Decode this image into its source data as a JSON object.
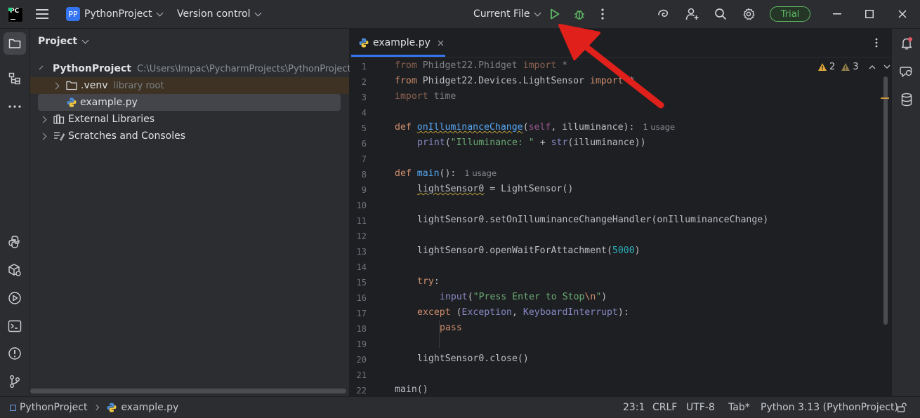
{
  "titlebar": {
    "app_logo": "PC",
    "project_badge": "PP",
    "project_name": "PythonProject",
    "vcs_label": "Version control",
    "run_config": "Current File",
    "trial_label": "Trial"
  },
  "project_panel": {
    "title": "Project",
    "tree": {
      "root_name": "PythonProject",
      "root_path": "C:\\Users\\Impac\\PycharmProjects\\PythonProject",
      "venv_name": ".venv",
      "venv_hint": "library root",
      "file_name": "example.py",
      "external_libraries": "External Libraries",
      "scratches": "Scratches and Consoles"
    }
  },
  "editor": {
    "tab_label": "example.py",
    "warnings_count": "2",
    "weak_warnings_count": "3",
    "line_numbers": [
      "1",
      "2",
      "3",
      "4",
      "5",
      "6",
      "7",
      "8",
      "9",
      "10",
      "11",
      "12",
      "13",
      "14",
      "15",
      "16",
      "17",
      "18",
      "19",
      "20",
      "21",
      "22"
    ],
    "code": {
      "l1_kw": "from",
      "l1_mod": " Phidget22.Phidget ",
      "l1_kw2": "import",
      "l1_rest": " *",
      "l2_kw": "from",
      "l2_mod": " Phidget22.Devices.LightSensor ",
      "l2_kw2": "import",
      "l2_rest": " *",
      "l3_kw": "import",
      "l3_rest": " time",
      "l5_kw": "def ",
      "l5_fn": "onIlluminanceChange",
      "l5_p1": "(",
      "l5_self": "self",
      "l5_p2": ", illuminance):",
      "l5_hint": "1 usage",
      "l6_fn": "print",
      "l6_p1": "(",
      "l6_str": "\"Illuminance: \"",
      "l6_p2": " + ",
      "l6_bi": "str",
      "l6_p3": "(illuminance))",
      "l8_kw": "def ",
      "l8_fn": "main",
      "l8_rest": "():",
      "l8_hint": "1 usage",
      "l9_var": "lightSensor0",
      "l9_rest": " = LightSensor()",
      "l11": "lightSensor0.setOnIlluminanceChangeHandler(onIlluminanceChange)",
      "l13_a": "lightSensor0.openWaitForAttachment(",
      "l13_num": "5000",
      "l13_b": ")",
      "l15_kw": "try",
      "l15_rest": ":",
      "l16_fn": "input",
      "l16_p1": "(",
      "l16_str": "\"Press Enter to Stop",
      "l16_esc": "\\n",
      "l16_str2": "\"",
      "l16_p2": ")",
      "l17_kw": "except",
      "l17_p1": " (",
      "l17_bi1": "Exception",
      "l17_p2": ", ",
      "l17_bi2": "KeyboardInterrupt",
      "l17_p3": "):",
      "l18_kw": "pass",
      "l20": "lightSensor0.close()",
      "l22": "main()"
    }
  },
  "statusbar": {
    "breadcrumb_project": "PythonProject",
    "breadcrumb_file": "example.py",
    "position": "23:1",
    "line_sep": "CRLF",
    "encoding": "UTF-8",
    "indent": "Tab*",
    "interpreter": "Python 3.13 (PythonProject)"
  },
  "colors": {
    "accent": "#3574f0",
    "run_green": "#5fb865",
    "annotation_arrow": "#e0201b"
  }
}
